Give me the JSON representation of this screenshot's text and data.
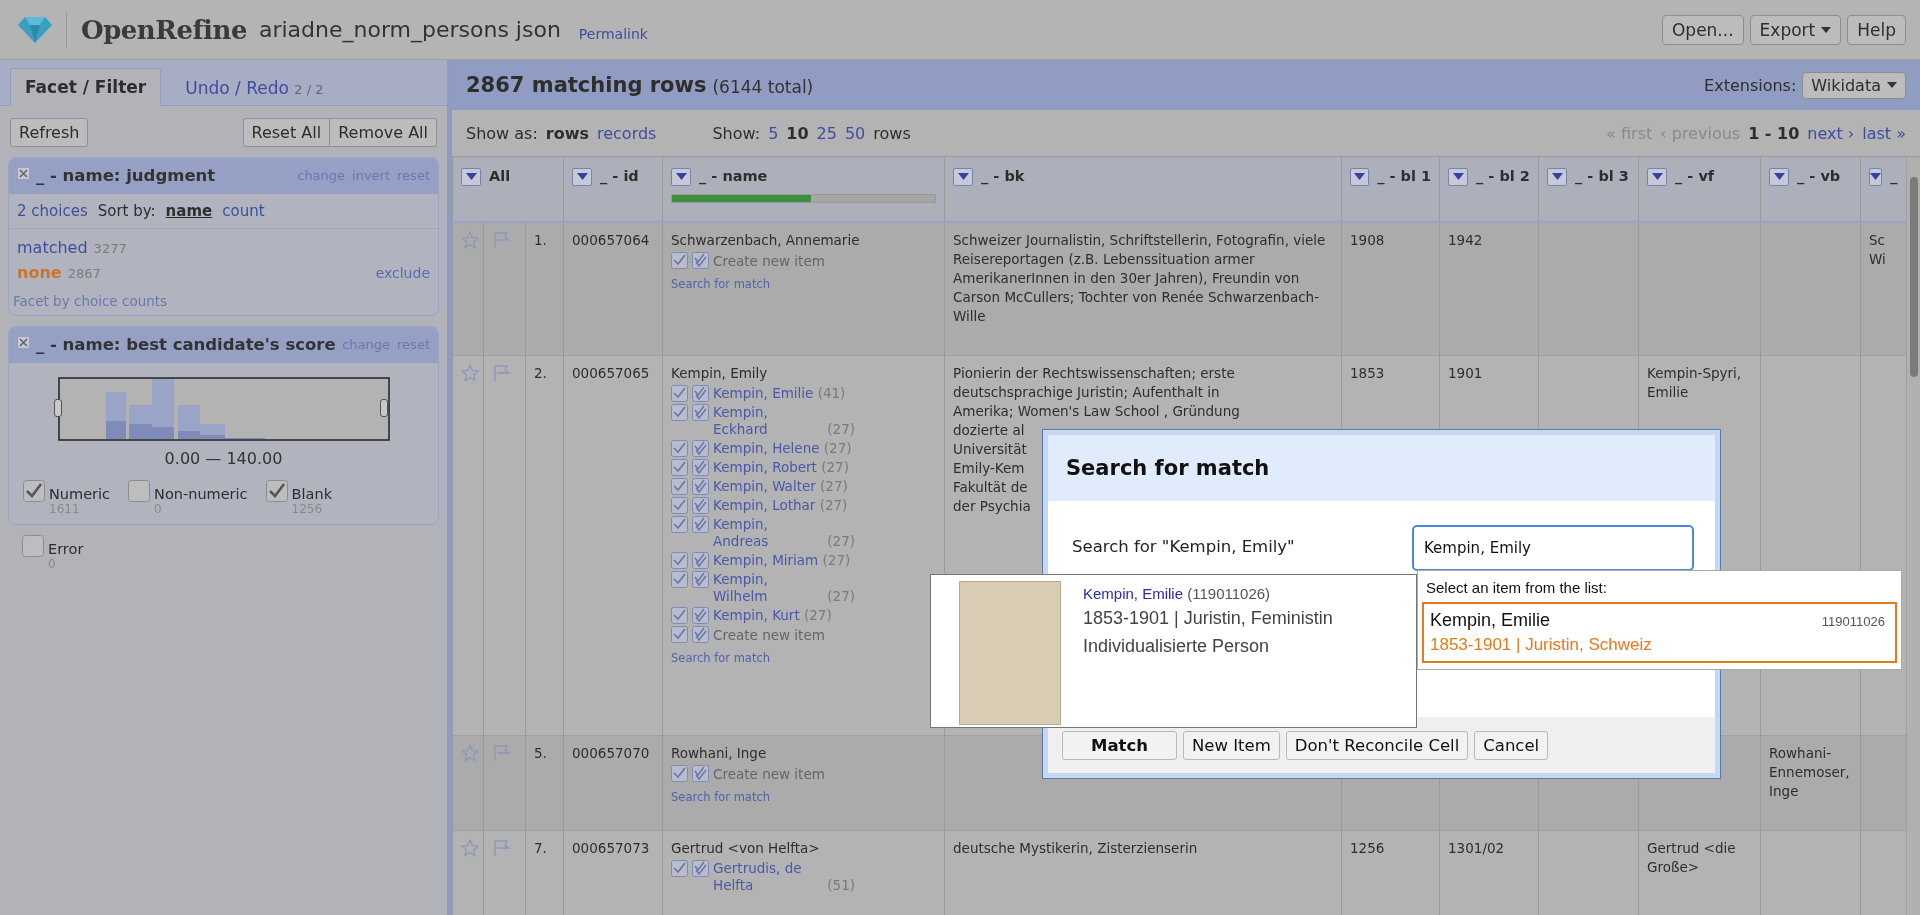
{
  "app": {
    "name": "OpenRefine",
    "project": "ariadne_norm_persons json",
    "permalink": "Permalink"
  },
  "top_buttons": [
    {
      "label": "Open...",
      "menu": false
    },
    {
      "label": "Export",
      "menu": true
    },
    {
      "label": "Help",
      "menu": false
    }
  ],
  "left_tabs": [
    {
      "label": "Facet / Filter",
      "selected": true
    },
    {
      "label": "Undo / Redo",
      "count": "2 / 2",
      "selected": false
    }
  ],
  "facet_actions": {
    "refresh": "Refresh",
    "reset_all": "Reset All",
    "remove_all": "Remove All"
  },
  "facets": [
    {
      "kind": "list",
      "title": "_ - name: judgment",
      "links": [
        "change",
        "invert",
        "reset"
      ],
      "choices_count": "2 choices",
      "sort_label": "Sort by:",
      "sort_options": [
        {
          "label": "name",
          "selected": true
        },
        {
          "label": "count",
          "selected": false
        }
      ],
      "choices": [
        {
          "label": "matched",
          "count": "3277",
          "selected": false
        },
        {
          "label": "none",
          "count": "2867",
          "selected": true,
          "action": "exclude"
        }
      ],
      "footer": "Facet by choice counts"
    },
    {
      "kind": "range",
      "title": "_ - name: best candidate's score",
      "links": [
        "change",
        "reset"
      ],
      "range": "0.00 — 140.00",
      "options": [
        {
          "label": "Numeric",
          "count": "1611",
          "checked": true
        },
        {
          "label": "Non-numeric",
          "count": "0",
          "checked": false
        },
        {
          "label": "Blank",
          "count": "1256",
          "checked": true
        }
      ],
      "outside_options": [
        {
          "label": "Error",
          "count": "0",
          "checked": false
        }
      ]
    }
  ],
  "grid": {
    "title": "2867 matching rows",
    "total": "(6144 total)",
    "extensions_label": "Extensions:",
    "extensions_button": "Wikidata",
    "show_as_label": "Show as:",
    "show_as": [
      {
        "label": "rows",
        "selected": true
      },
      {
        "label": "records",
        "selected": false
      }
    ],
    "show_label": "Show:",
    "page_sizes": [
      {
        "label": "5",
        "selected": false
      },
      {
        "label": "10",
        "selected": true
      },
      {
        "label": "25",
        "selected": false
      },
      {
        "label": "50",
        "selected": false
      }
    ],
    "rows_label": "rows",
    "pager": [
      {
        "kind": "link",
        "label": "« first",
        "disabled": true
      },
      {
        "kind": "link",
        "label": "‹ previous",
        "disabled": true
      },
      {
        "kind": "range",
        "label": "1 - 10"
      },
      {
        "kind": "link",
        "label": "next ›",
        "disabled": false
      },
      {
        "kind": "link",
        "label": "last »",
        "disabled": false
      }
    ],
    "columns": [
      {
        "label": "All"
      },
      {
        "label": "_ - id"
      },
      {
        "label": "_ - name",
        "level": 0.53
      },
      {
        "label": "_ - bk"
      },
      {
        "label": "_ - bl 1"
      },
      {
        "label": "_ - bl 2"
      },
      {
        "label": "_ - bl 3"
      },
      {
        "label": "_ - vf"
      },
      {
        "label": "_ - vb"
      },
      {
        "label": "_"
      }
    ],
    "rows": [
      {
        "starred": false,
        "flagged": false,
        "cells": [
          "1.",
          "000657064",
          {
            "value": "Schwarzenbach, Annemarie",
            "create_new": "Create new item",
            "search_link": "Search for match"
          },
          "Schweizer Journalistin, Schriftstellerin, Fotografin, viele Reisereportagen (z.B. Lebenssituation armer AmerikanerInnen in den 30er Jahren), Freundin von Carson McCullers; Tochter von Renée Schwarzenbach-Wille",
          "1908",
          "1942",
          "",
          "",
          "",
          "Sc Wi"
        ]
      },
      {
        "starred": false,
        "flagged": false,
        "cells": [
          "2.",
          "000657065",
          {
            "value": "Kempin, Emily",
            "candidates": [
              {
                "name": "Kempin, Emilie",
                "score": "(41)"
              },
              {
                "name": "Kempin, Eckhard",
                "score": "(27)"
              },
              {
                "name": "Kempin, Helene",
                "score": "(27)"
              },
              {
                "name": "Kempin, Robert",
                "score": "(27)"
              },
              {
                "name": "Kempin, Walter",
                "score": "(27)"
              },
              {
                "name": "Kempin, Lothar",
                "score": "(27)"
              },
              {
                "name": "Kempin, Andreas",
                "score": "(27)"
              },
              {
                "name": "Kempin, Miriam",
                "score": "(27)"
              },
              {
                "name": "Kempin, Wilhelm",
                "score": "(27)"
              },
              {
                "name": "Kempin, Kurt",
                "score": "(27)"
              }
            ],
            "create_new": "Create new item",
            "search_link": "Search for match"
          },
          [
            "Pionierin der Rechtswissenschaften; erste",
            "deutschsprachige Juristin; Aufenthalt in",
            "Amerika; Women's Law School , Gründung",
            "dozierte al",
            "Universität",
            "Emily-Kem",
            "Fakultät de",
            "der Psychia"
          ],
          "1853",
          "1901",
          "",
          "Kempin-Spyri, Emilie",
          "",
          ""
        ]
      },
      {
        "starred": false,
        "flagged": false,
        "cells": [
          "5.",
          "000657070",
          {
            "value": "Rowhani, Inge",
            "create_new": "Create new item",
            "search_link": "Search for match"
          },
          "",
          "",
          "",
          "",
          "",
          "Rowhani-Ennemoser, Inge",
          ""
        ]
      },
      {
        "starred": false,
        "flagged": false,
        "cells": [
          "7.",
          "000657073",
          {
            "value": "Gertrud <von Helfta>",
            "candidates": [
              {
                "name": "Gertrudis, de Helfta",
                "score": "(51)"
              }
            ]
          },
          "deutsche Mystikerin, Zisterzienserin",
          "1256",
          "1301/02",
          "",
          "Gertrud <die Große>",
          "",
          ""
        ]
      }
    ]
  },
  "dialog": {
    "title": "Search for match",
    "search_label": "Search for \"Kempin, Emily\"",
    "search_value": "Kempin, Emily",
    "buttons": [
      {
        "label": "Match",
        "primary": true
      },
      {
        "label": "New Item",
        "primary": false
      },
      {
        "label": "Don't Reconcile Cell",
        "primary": false
      },
      {
        "label": "Cancel",
        "primary": false
      }
    ],
    "preview": {
      "name": "Kempin, Emilie",
      "id": "(119011026)",
      "description": "1853-1901 | Juristin, Feministin",
      "type": "Individualisierte Person"
    },
    "suggest": {
      "hint": "Select an item from the list:",
      "items": [
        {
          "name": "Kempin, Emilie",
          "id": "119011026",
          "description": "1853-1901 | Juristin, Schweiz",
          "selected": true
        }
      ]
    }
  }
}
